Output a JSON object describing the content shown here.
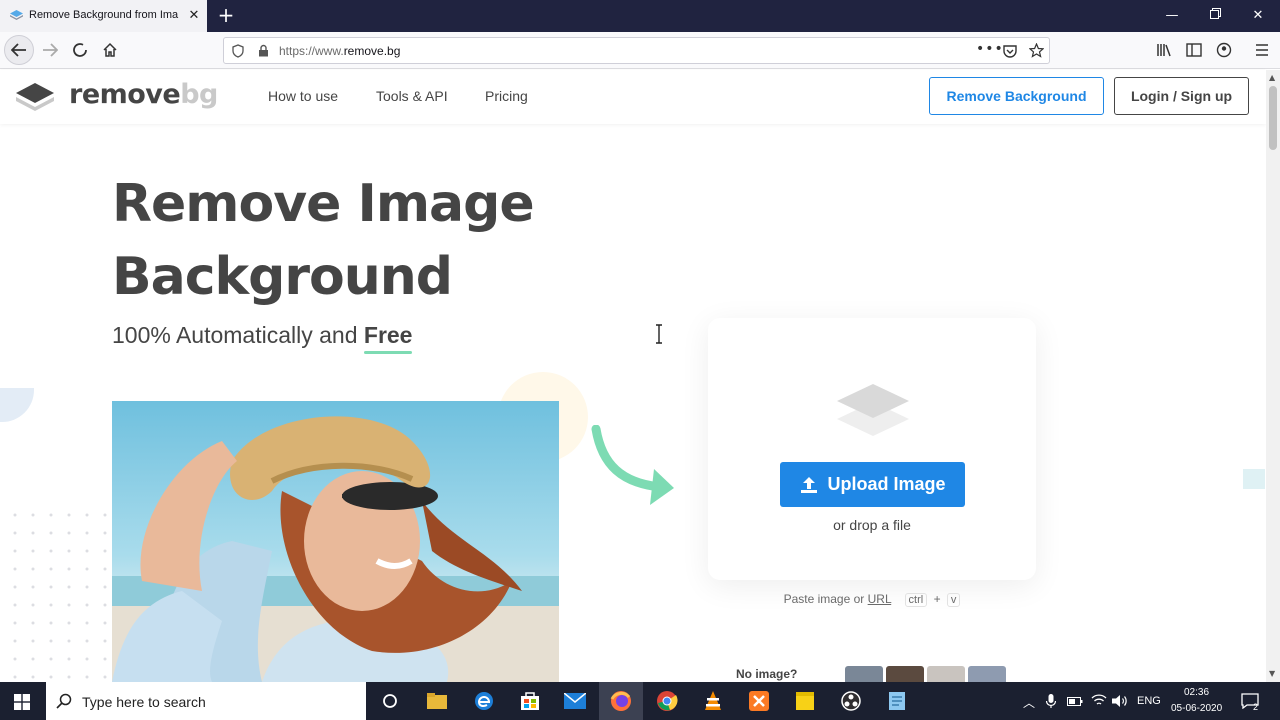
{
  "browser": {
    "tab_title": "Remove Background from Ima",
    "url_prefix": "https://www.",
    "url_domain": "remove.bg"
  },
  "site": {
    "logo_main": "remove",
    "logo_bg": "bg",
    "nav": [
      "How to use",
      "Tools & API",
      "Pricing"
    ],
    "cta_primary": "Remove Background",
    "cta_login": "Login / Sign up",
    "brand_color": "#1f87e5"
  },
  "hero": {
    "title_line1": "Remove Image",
    "title_line2": "Background",
    "subtitle_prefix": "100% Automatically and",
    "subtitle_free": "Free"
  },
  "upload": {
    "button_label": "Upload Image",
    "drop_text": "or drop a file",
    "paste_prefix": "Paste image or",
    "paste_url": "URL",
    "key_ctrl": "ctrl",
    "key_plus": "+",
    "key_v": "v",
    "no_image": "No image?"
  },
  "taskbar": {
    "search_placeholder": "Type here to search",
    "language": "ENG",
    "time": "02:36",
    "date": "05-06-2020",
    "notifications": "2"
  }
}
